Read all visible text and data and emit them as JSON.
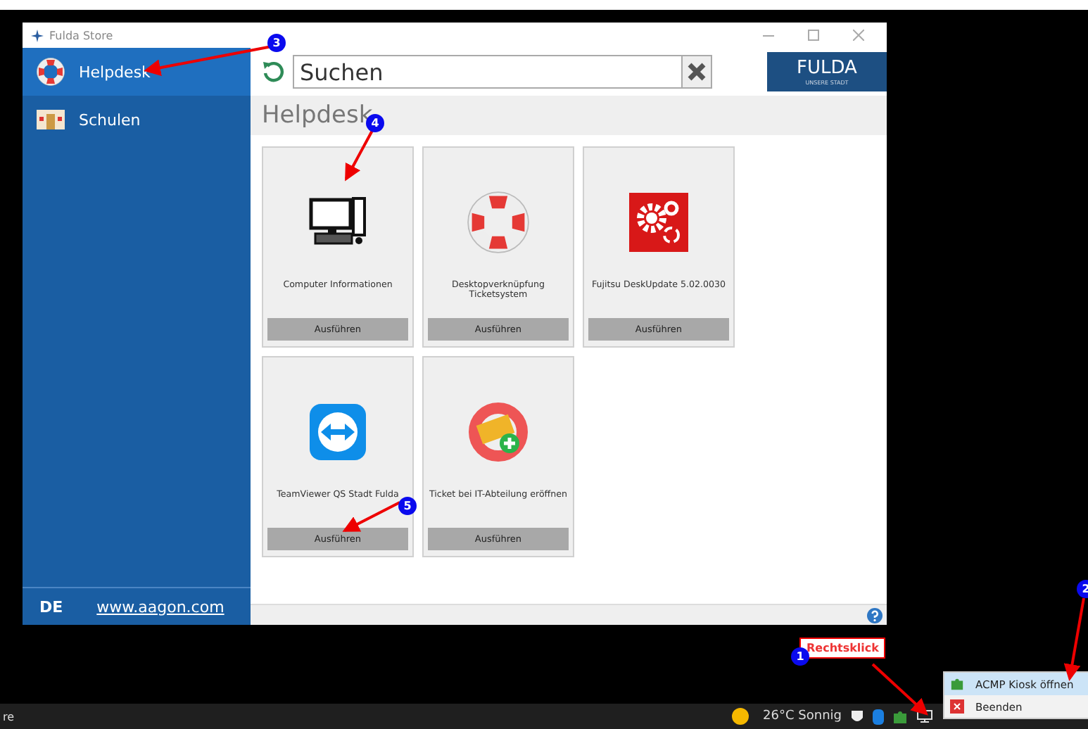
{
  "window": {
    "title": "Fulda Store"
  },
  "sidebar": {
    "items": [
      {
        "label": "Helpdesk",
        "kind": "lifebuoy",
        "selected": true
      },
      {
        "label": "Schulen",
        "kind": "building",
        "selected": false
      }
    ],
    "language": "DE",
    "link": "www.aagon.com"
  },
  "search": {
    "placeholder": "Suchen"
  },
  "logo": {
    "title": "FULDA",
    "subtitle": "UNSERE STADT"
  },
  "section_title": "Helpdesk",
  "tiles": [
    {
      "name": "Computer Informationen",
      "kind": "computer",
      "button": "Ausführen"
    },
    {
      "name": "Desktopverknüpfung Ticketsystem",
      "kind": "lifebuoy",
      "button": "Ausführen"
    },
    {
      "name": "Fujitsu DeskUpdate 5.02.0030",
      "kind": "gears",
      "button": "Ausführen"
    },
    {
      "name": "TeamViewer QS Stadt Fulda",
      "kind": "remote",
      "button": "Ausführen"
    },
    {
      "name": "Ticket bei IT-Abteilung eröffnen",
      "kind": "ticket",
      "button": "Ausführen"
    }
  ],
  "taskbar": {
    "app_label": "re",
    "weather": "26°C Sonnig"
  },
  "context_menu": {
    "items": [
      {
        "label": "ACMP Kiosk öffnen",
        "kind": "puzzle",
        "selected": true
      },
      {
        "label": "Beenden",
        "kind": "close",
        "selected": false
      }
    ]
  },
  "annotations": {
    "callout": "Rechtsklick",
    "markers": [
      "1",
      "2",
      "3",
      "4",
      "5"
    ]
  }
}
